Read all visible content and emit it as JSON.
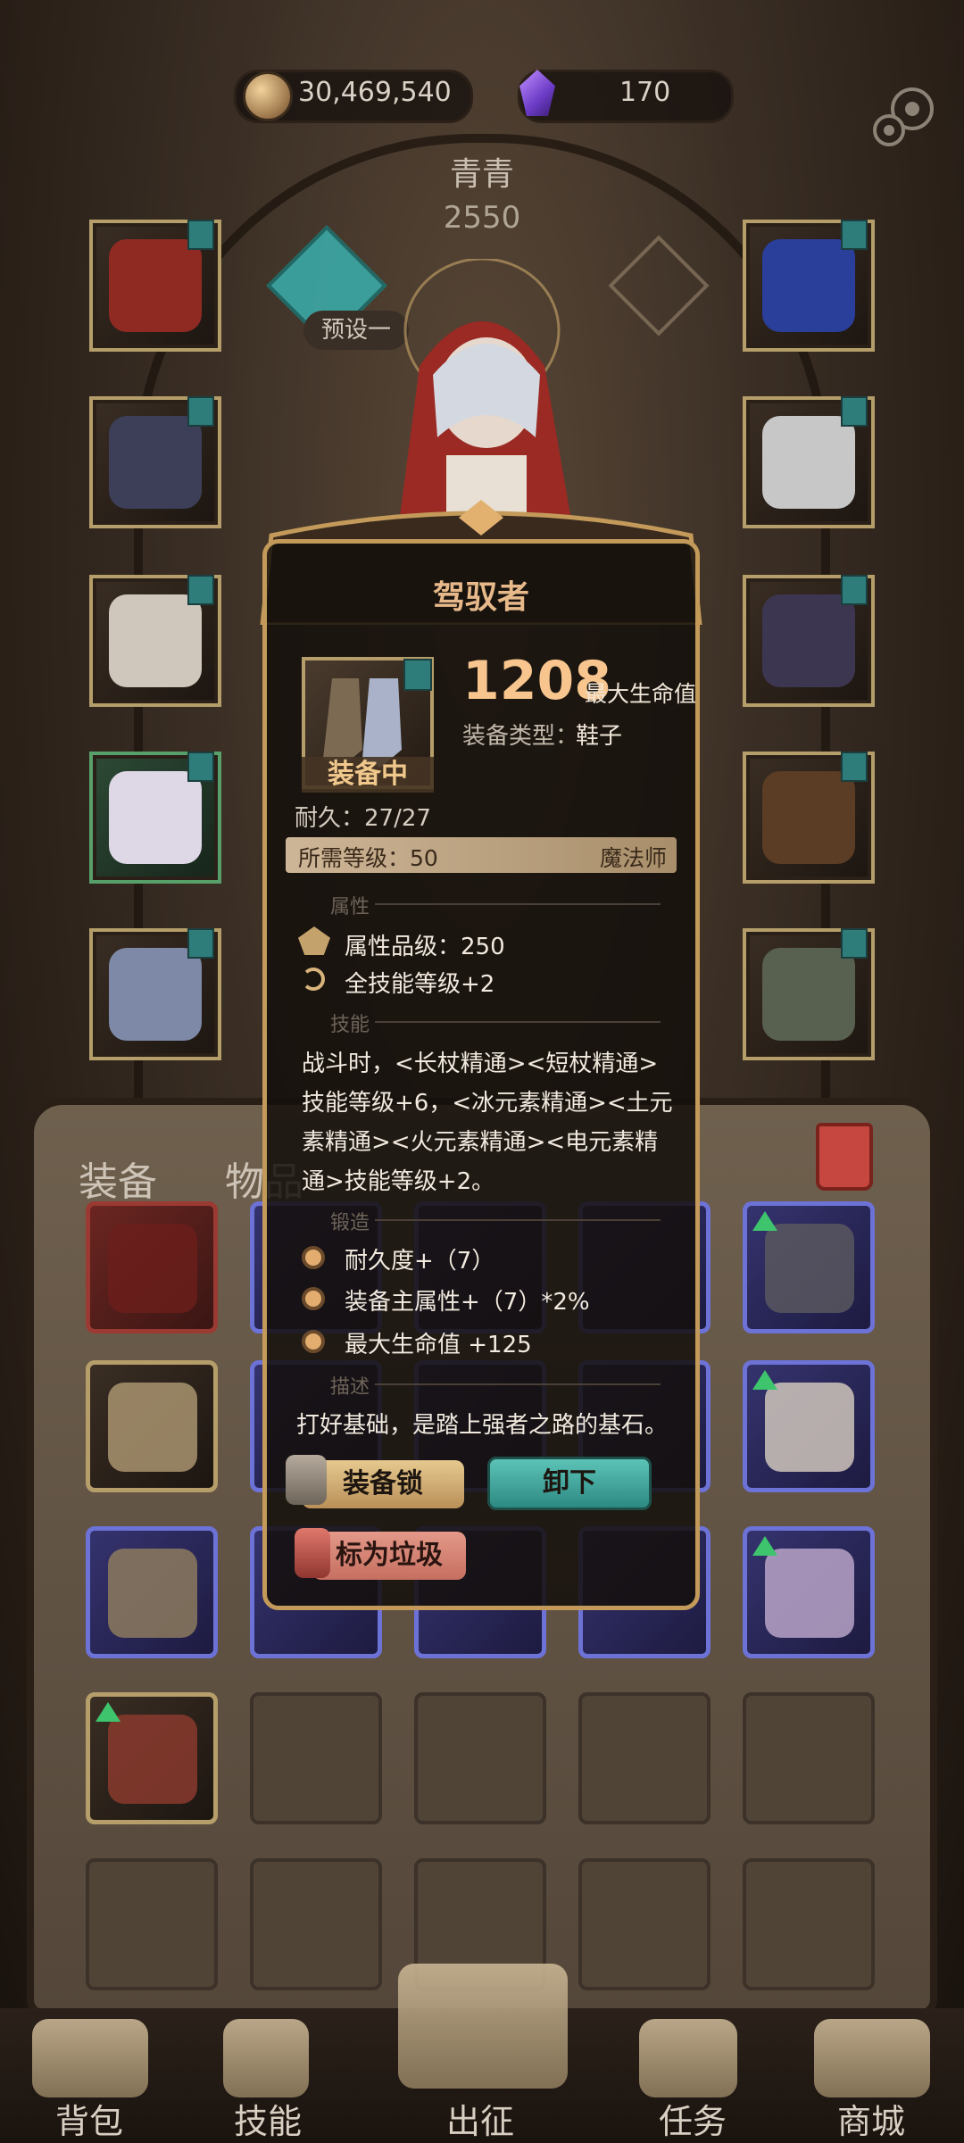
{
  "currency": {
    "gold": "30,469,540",
    "gems": "170"
  },
  "character": {
    "name": "青青",
    "power": "2550",
    "preset_label": "预设一"
  },
  "bag_tabs": {
    "equipment": "装备",
    "items": "物品"
  },
  "popup": {
    "title": "驾驭者",
    "equipped_badge": "装备中",
    "main_value": "1208",
    "main_stat": "最大生命值",
    "type_label": "装备类型：",
    "type_value": "鞋子",
    "durability": "耐久：27/27",
    "required_level": "所需等级：50",
    "required_class": "魔法师",
    "sections": {
      "attributes": "属性",
      "skills": "技能",
      "forge": "锻造",
      "description": "描述"
    },
    "attributes": [
      "属性品级：250",
      "全技能等级+2"
    ],
    "skill_text": "战斗时，<长杖精通><短杖精通>技能等级+6，<冰元素精通><土元素精通><火元素精通><电元素精通>技能等级+2。",
    "forge": [
      "耐久度+（7）",
      "装备主属性+（7）*2%",
      "最大生命值 +125"
    ],
    "description_text": "打好基础，是踏上强者之路的基石。",
    "buttons": {
      "lock": "装备锁",
      "unequip": "卸下",
      "mark_trash": "标为垃圾"
    }
  },
  "nav": [
    "背包",
    "技能",
    "出征",
    "任务",
    "商城"
  ],
  "colors": {
    "accent_gold": "#f7c58d",
    "teal": "#3ba9a7",
    "upgrade_green": "#3ec46d"
  }
}
